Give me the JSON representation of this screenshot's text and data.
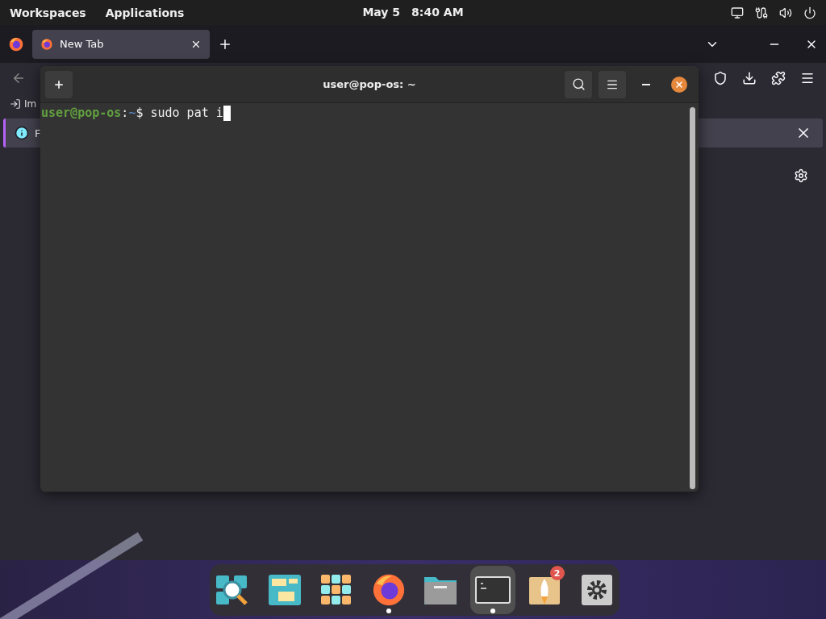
{
  "top_bar": {
    "menus": [
      {
        "label": "Workspaces"
      },
      {
        "label": "Applications"
      }
    ],
    "date": "May 5",
    "time": "8:40 AM"
  },
  "browser": {
    "tabs": [
      {
        "label": "New Tab",
        "selected": true
      }
    ],
    "bookmark": "Im",
    "notice": "F"
  },
  "terminal": {
    "title": "user@pop-os: ~",
    "prompt_user": "user@pop-os",
    "prompt_sep": ":",
    "prompt_path": "~",
    "prompt_symbol": "$",
    "command": "sudo pat i"
  },
  "dock": [
    {
      "kind": "search",
      "running": false,
      "selected": false
    },
    {
      "kind": "workspaces",
      "running": false,
      "selected": false
    },
    {
      "kind": "apps",
      "running": false,
      "selected": false
    },
    {
      "kind": "firefox",
      "running": true,
      "selected": false
    },
    {
      "kind": "files",
      "running": false,
      "selected": false
    },
    {
      "kind": "terminal",
      "running": true,
      "selected": true
    },
    {
      "kind": "shop",
      "running": false,
      "selected": false,
      "badge": "2"
    },
    {
      "kind": "settings",
      "running": false,
      "selected": false
    }
  ]
}
